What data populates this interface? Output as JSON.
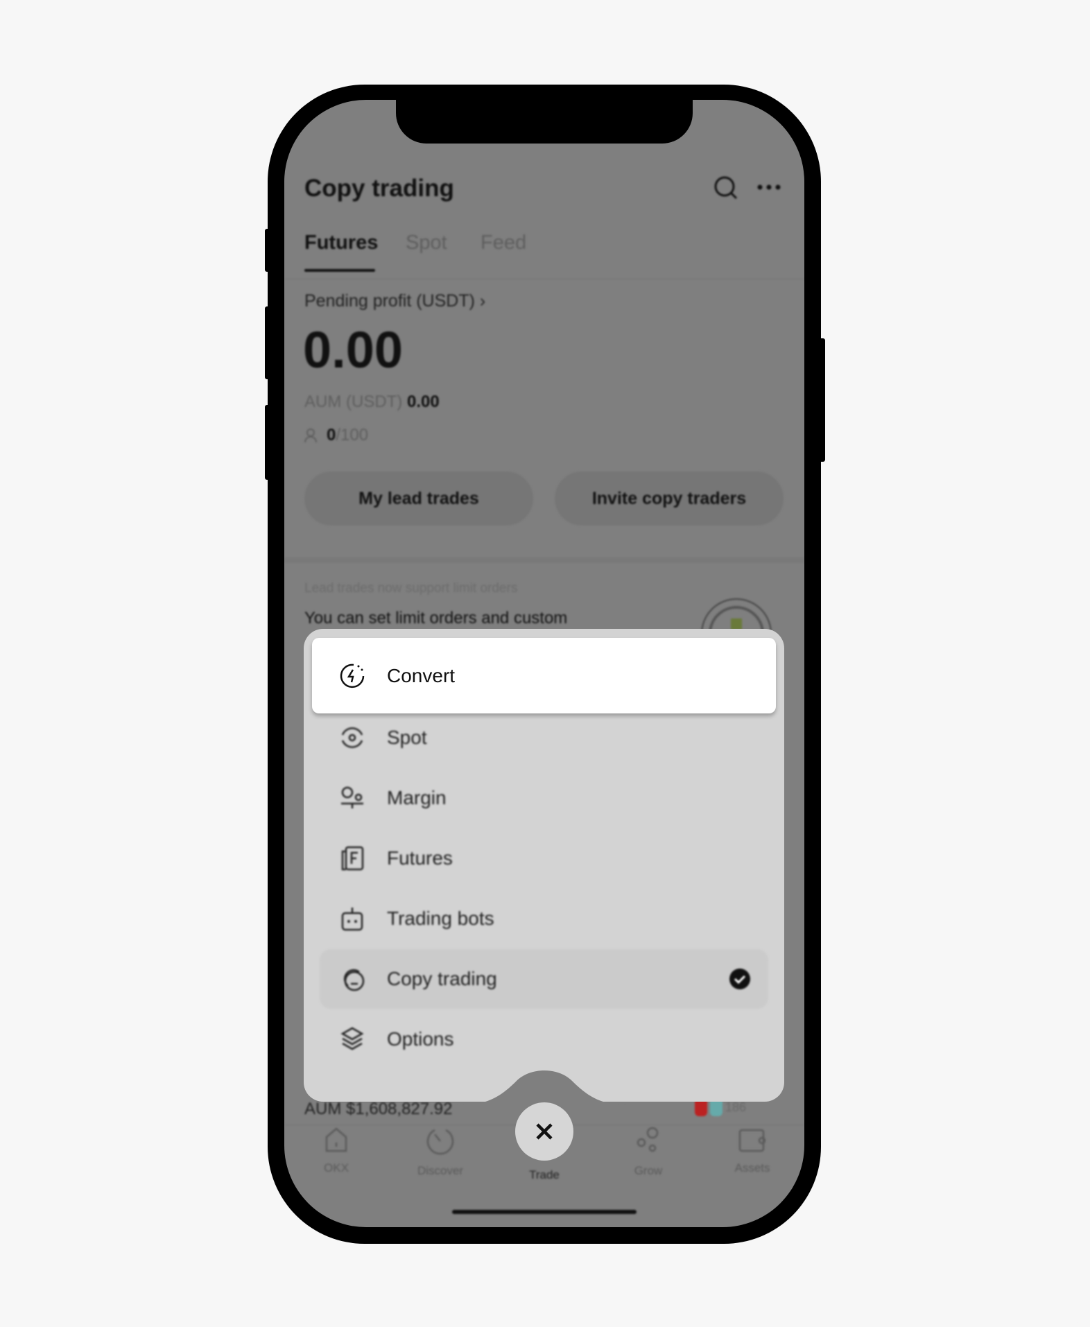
{
  "header": {
    "title": "Copy trading",
    "search_icon": "search-icon",
    "more_icon": "more-icon"
  },
  "tabs": [
    {
      "label": "Futures",
      "active": true
    },
    {
      "label": "Spot"
    },
    {
      "label": "Feed"
    }
  ],
  "summary": {
    "pending_label": "Pending profit (USDT)",
    "pending_value": "0.00",
    "aum_label": "AUM (USDT)",
    "aum_value": "0.00",
    "copiers_current": "0",
    "copiers_max": "/100"
  },
  "actions": {
    "lead_trades": "My lead trades",
    "invite": "Invite copy traders"
  },
  "banner": {
    "subtitle": "Lead trades now support limit orders",
    "text": "You can set limit orders and custom"
  },
  "trader": {
    "aum": "AUM $1,608,827.92",
    "count": "186"
  },
  "menu": {
    "items": [
      {
        "label": "Convert",
        "icon": "convert-icon",
        "highlighted": true
      },
      {
        "label": "Spot",
        "icon": "spot-icon"
      },
      {
        "label": "Margin",
        "icon": "margin-icon"
      },
      {
        "label": "Futures",
        "icon": "futures-icon"
      },
      {
        "label": "Trading bots",
        "icon": "bot-icon"
      },
      {
        "label": "Copy trading",
        "icon": "copy-trading-icon",
        "selected": true
      },
      {
        "label": "Options",
        "icon": "layers-icon"
      }
    ]
  },
  "nav": [
    {
      "label": "OKX"
    },
    {
      "label": "Discover"
    },
    {
      "label": "Trade",
      "active": true
    },
    {
      "label": "Grow"
    },
    {
      "label": "Assets"
    }
  ]
}
